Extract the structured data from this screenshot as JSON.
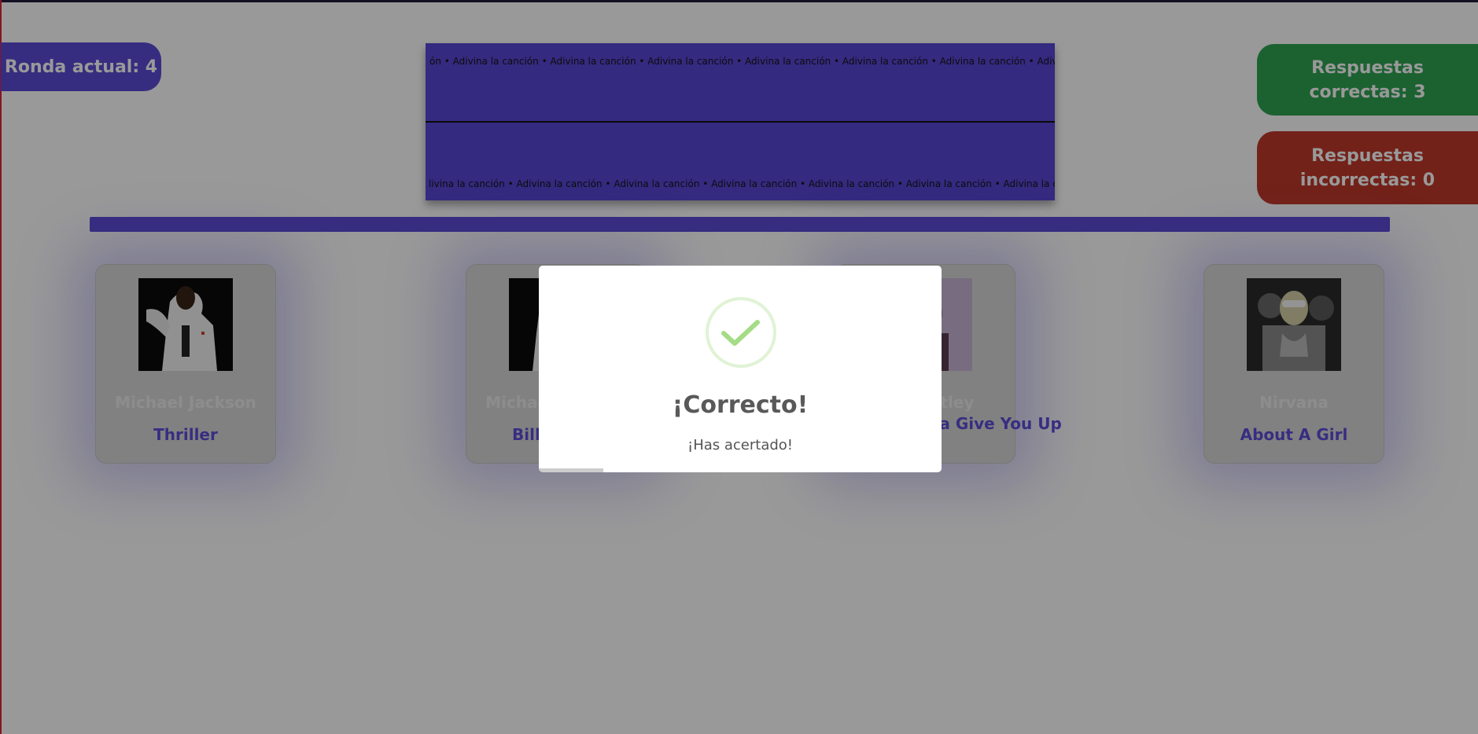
{
  "header": {
    "round_label": "Ronda actual: 4",
    "correct_label": "Respuestas correctas: 3",
    "incorrect_label": "Respuestas incorrectas: 0"
  },
  "banner": {
    "marquee_top": "ón • Adivina la canción • Adivina la canción • Adivina la canción • Adivina la canción • Adivina la canción • Adivina la canción • Adivina la canción",
    "marquee_bottom": "livina la canción • Adivina la canción • Adivina la canción • Adivina la canción • Adivina la canción • Adivina la canción • Adivina la canción"
  },
  "options": [
    {
      "artist": "Michael Jackson",
      "song": "Thriller",
      "cover": "michael-jackson-album-cover"
    },
    {
      "artist": "Michael Jackson",
      "song": "Billie Jean",
      "cover": "michael-jackson-album-cover"
    },
    {
      "artist": "Rick Astley",
      "song": "Never Gonna Give You Up",
      "cover": "rick-astley-album-cover"
    },
    {
      "artist": "Nirvana",
      "song": "About A Girl",
      "cover": "nirvana-band-photo"
    }
  ],
  "modal": {
    "title": "¡Correcto!",
    "text": "¡Has acertado!",
    "icon": "success-check-icon",
    "timer_progress": 0.16
  },
  "colors": {
    "accent": "#5b4bd6",
    "correct": "#2fa352",
    "incorrect": "#c0392b",
    "success_check": "#a5dc86"
  }
}
